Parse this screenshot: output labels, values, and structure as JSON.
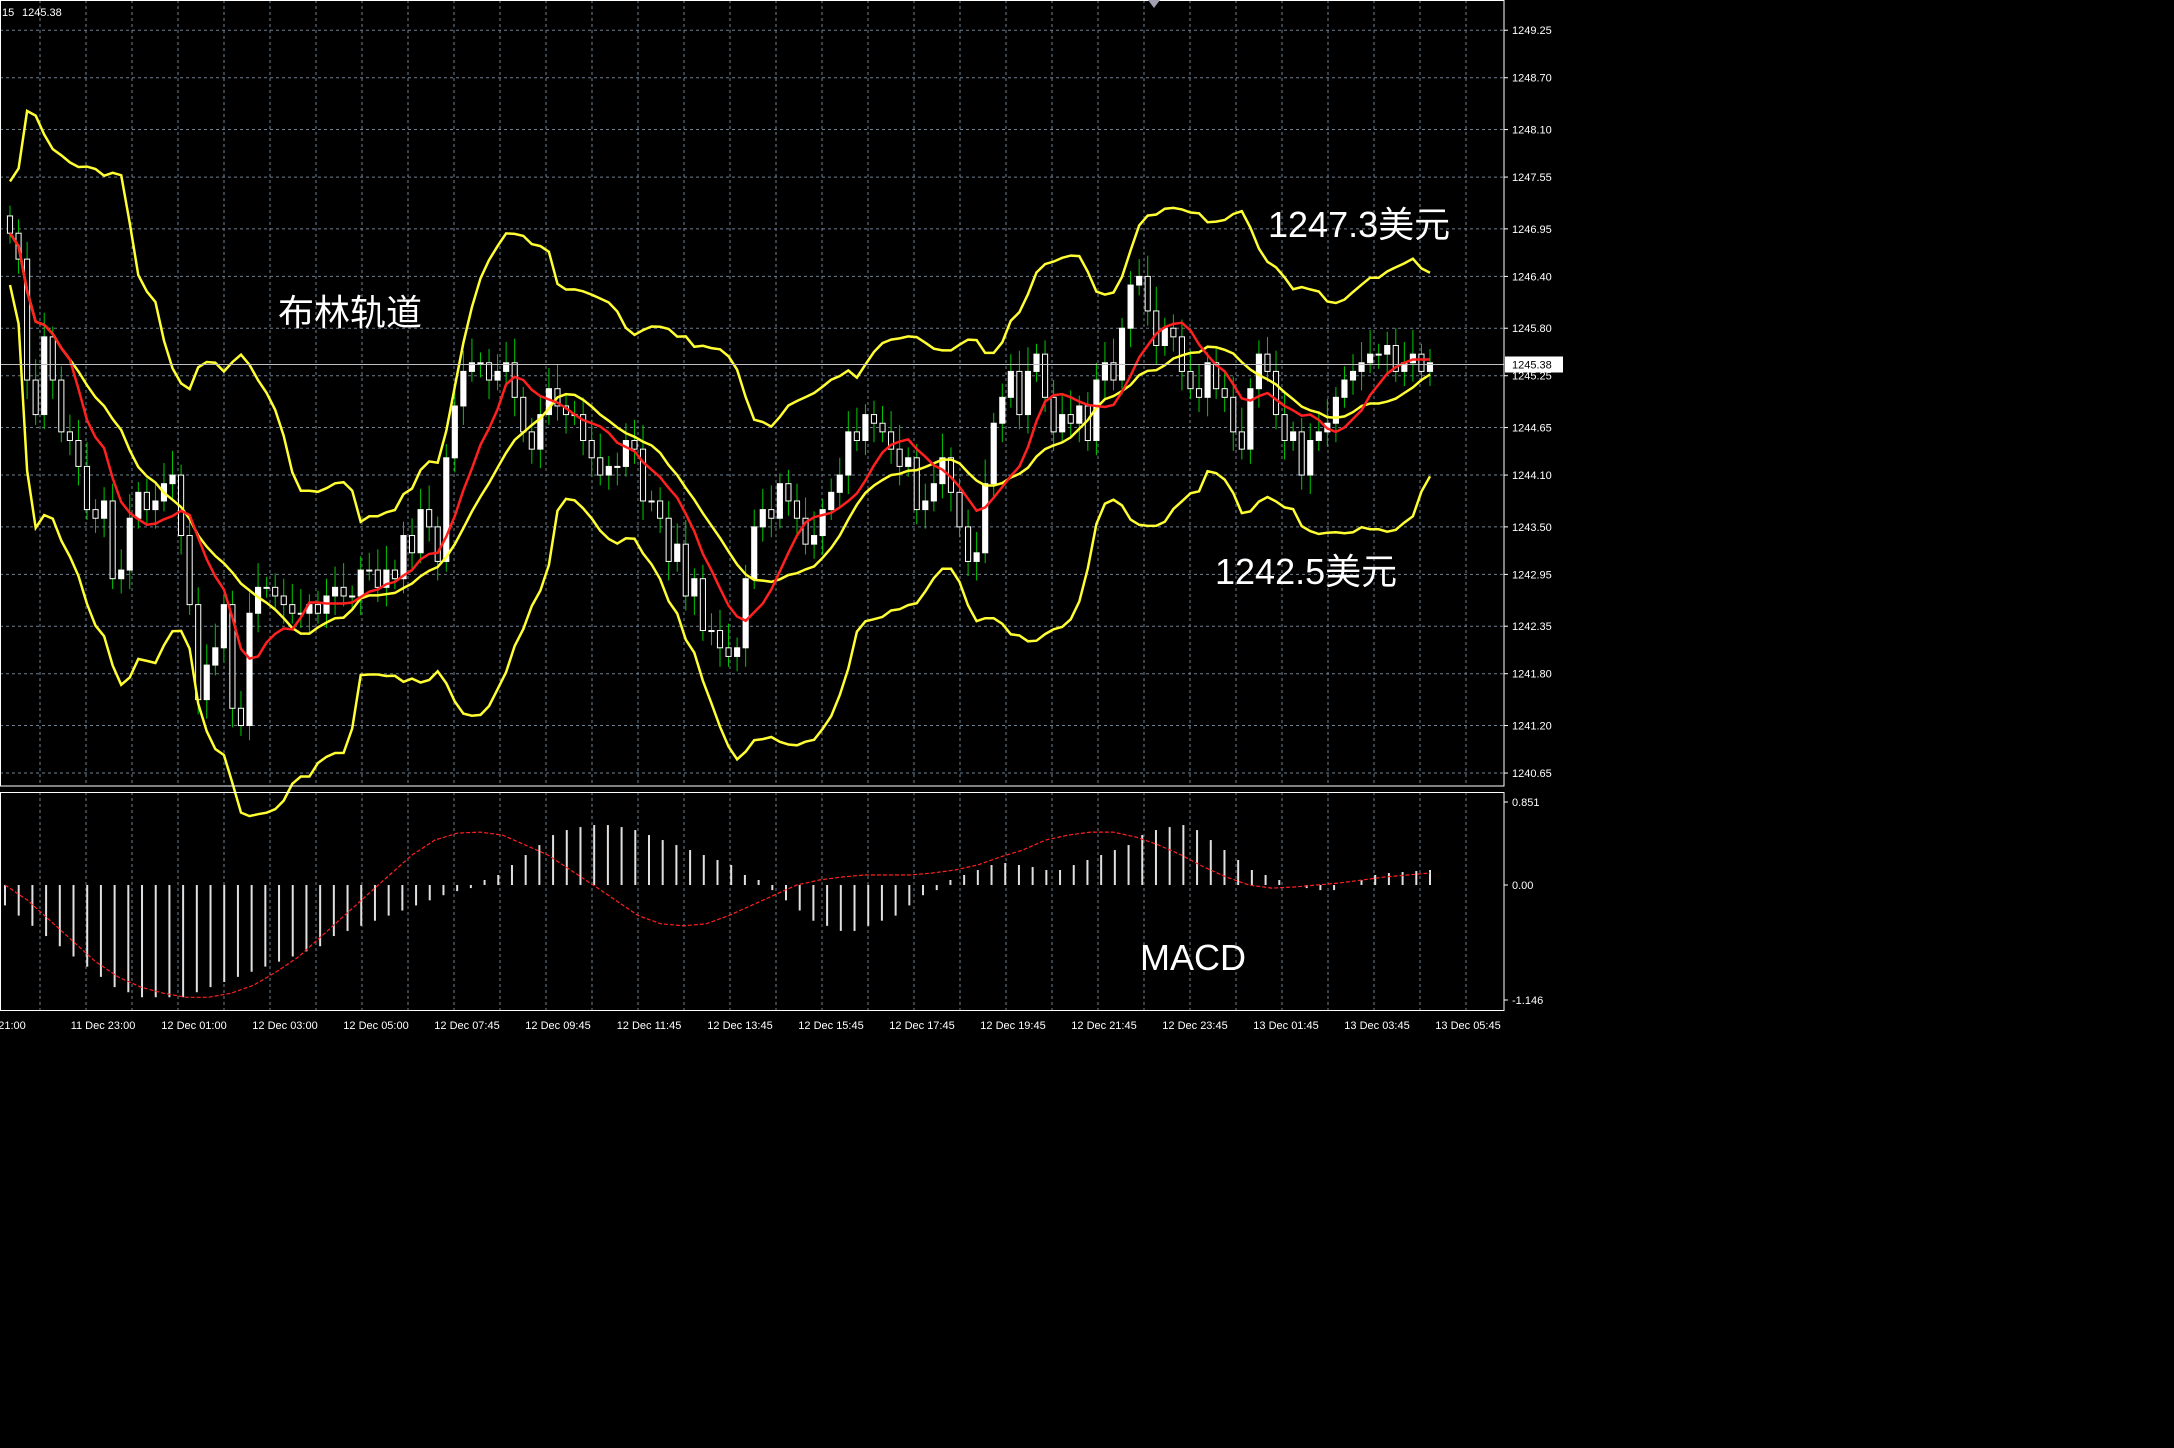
{
  "header": {
    "symbol_label": "15",
    "price_label": "1245.38"
  },
  "annotations": {
    "bands": "布林轨道",
    "upper_target": "1247.3美元",
    "lower_target": "1242.5美元",
    "macd": "MACD"
  },
  "colors": {
    "background": "#000000",
    "grid": "#6f8090",
    "axis_text": "#ffffff",
    "bull_candle": "#ffffff",
    "bear_candle": "#ffffff",
    "wick": "#00c800",
    "band": "#ffff33",
    "middle_ma": "#ffff33",
    "fast_ma": "#ff2020",
    "macd_hist": "#e0e0e0",
    "signal": "#ff2020"
  },
  "chart_data": [
    {
      "type": "candlestick",
      "title": "",
      "ylim": [
        1240.5,
        1249.6
      ],
      "y_ticks": [
        "1249.25",
        "1248.70",
        "1248.10",
        "1247.55",
        "1246.95",
        "1246.40",
        "1245.80",
        "1245.25",
        "1244.65",
        "1244.10",
        "1243.50",
        "1242.95",
        "1242.35",
        "1241.80",
        "1241.20",
        "1240.65"
      ],
      "current_price": "1245.38",
      "x_tick_labels": [
        "21:00",
        "11 Dec 23:00",
        "12 Dec 01:00",
        "12 Dec 03:00",
        "12 Dec 05:00",
        "12 Dec 07:45",
        "12 Dec 09:45",
        "12 Dec 11:45",
        "12 Dec 13:45",
        "12 Dec 15:45",
        "12 Dec 17:45",
        "12 Dec 19:45",
        "12 Dec 21:45",
        "12 Dec 23:45",
        "13 Dec 01:45",
        "13 Dec 03:45",
        "13 Dec 05:45"
      ],
      "close": [
        1246.9,
        1246.6,
        1245.2,
        1244.8,
        1245.7,
        1245.2,
        1244.6,
        1244.5,
        1244.2,
        1243.7,
        1243.6,
        1243.8,
        1242.9,
        1243.0,
        1243.6,
        1243.9,
        1243.7,
        1243.8,
        1244.0,
        1244.1,
        1243.4,
        1242.6,
        1241.5,
        1241.9,
        1242.1,
        1242.6,
        1241.4,
        1241.2,
        1242.5,
        1242.8,
        1242.8,
        1242.7,
        1242.6,
        1242.5,
        1242.5,
        1242.6,
        1242.5,
        1242.7,
        1242.8,
        1242.7,
        1242.7,
        1243.0,
        1243.0,
        1242.8,
        1243.0,
        1242.9,
        1243.4,
        1243.2,
        1243.7,
        1243.5,
        1243.1,
        1244.3,
        1244.9,
        1245.3,
        1245.4,
        1245.4,
        1245.2,
        1245.3,
        1245.4,
        1245.0,
        1244.6,
        1244.4,
        1244.8,
        1245.1,
        1244.9,
        1244.8,
        1244.8,
        1244.5,
        1244.3,
        1244.1,
        1244.2,
        1244.2,
        1244.5,
        1244.4,
        1243.8,
        1243.8,
        1243.6,
        1243.1,
        1243.3,
        1242.7,
        1242.9,
        1242.3,
        1242.3,
        1242.1,
        1242.0,
        1242.1,
        1242.9,
        1243.5,
        1243.7,
        1243.6,
        1244.0,
        1243.8,
        1243.6,
        1243.3,
        1243.4,
        1243.7,
        1243.9,
        1244.1,
        1244.6,
        1244.5,
        1244.8,
        1244.7,
        1244.6,
        1244.4,
        1244.2,
        1244.3,
        1243.7,
        1243.8,
        1244.0,
        1244.3,
        1243.9,
        1243.5,
        1243.1,
        1243.2,
        1244.0,
        1244.7,
        1245.0,
        1245.3,
        1244.8,
        1245.3,
        1245.5,
        1245.0,
        1244.6,
        1244.8,
        1244.7,
        1244.9,
        1244.5,
        1245.2,
        1245.4,
        1245.2,
        1245.8,
        1246.3,
        1246.4,
        1246.0,
        1245.6,
        1245.8,
        1245.7,
        1245.3,
        1245.1,
        1245.0,
        1245.4,
        1245.1,
        1245.0,
        1244.6,
        1244.4,
        1245.1,
        1245.5,
        1245.3,
        1244.8,
        1244.5,
        1244.6,
        1244.1,
        1244.5,
        1244.6,
        1244.7,
        1245.0,
        1245.2,
        1245.3,
        1245.4,
        1245.5,
        1245.5,
        1245.6,
        1245.3,
        1245.4,
        1245.5,
        1245.3,
        1245.4
      ]
    },
    {
      "type": "bar",
      "title": "",
      "ylim": [
        -1.146,
        0.851
      ],
      "y_ticks": [
        "0.851",
        "0.00",
        "-1.146"
      ],
      "values": [
        -0.2,
        -0.3,
        -0.4,
        -0.5,
        -0.6,
        -0.7,
        -0.8,
        -0.9,
        -1.0,
        -1.05,
        -1.1,
        -1.1,
        -1.1,
        -1.1,
        -1.05,
        -1.0,
        -0.95,
        -0.9,
        -0.85,
        -0.8,
        -0.75,
        -0.7,
        -0.65,
        -0.6,
        -0.5,
        -0.45,
        -0.4,
        -0.35,
        -0.3,
        -0.25,
        -0.2,
        -0.15,
        -0.1,
        -0.06,
        -0.03,
        0.05,
        0.1,
        0.2,
        0.3,
        0.4,
        0.5,
        0.55,
        0.58,
        0.6,
        0.6,
        0.58,
        0.55,
        0.5,
        0.45,
        0.4,
        0.35,
        0.3,
        0.25,
        0.2,
        0.1,
        0.05,
        -0.05,
        -0.15,
        -0.25,
        -0.35,
        -0.4,
        -0.45,
        -0.45,
        -0.4,
        -0.35,
        -0.3,
        -0.2,
        -0.1,
        -0.05,
        0.05,
        0.1,
        0.15,
        0.2,
        0.22,
        0.2,
        0.18,
        0.15,
        0.15,
        0.2,
        0.25,
        0.3,
        0.35,
        0.4,
        0.5,
        0.55,
        0.58,
        0.6,
        0.55,
        0.45,
        0.35,
        0.25,
        0.15,
        0.1,
        0.05,
        0.0,
        -0.03,
        -0.05,
        -0.05,
        0.0,
        0.05,
        0.1,
        0.12,
        0.13,
        0.14,
        0.15
      ],
      "signal": [
        0.0,
        -0.15,
        -0.35,
        -0.55,
        -0.75,
        -0.9,
        -1.0,
        -1.06,
        -1.1,
        -1.1,
        -1.06,
        -0.98,
        -0.85,
        -0.7,
        -0.5,
        -0.3,
        -0.1,
        0.1,
        0.3,
        0.45,
        0.52,
        0.53,
        0.5,
        0.4,
        0.3,
        0.15,
        0.0,
        -0.15,
        -0.3,
        -0.38,
        -0.4,
        -0.38,
        -0.3,
        -0.2,
        -0.1,
        0.0,
        0.05,
        0.08,
        0.1,
        0.1,
        0.1,
        0.12,
        0.15,
        0.2,
        0.28,
        0.35,
        0.45,
        0.5,
        0.53,
        0.53,
        0.48,
        0.4,
        0.3,
        0.18,
        0.08,
        0.0,
        -0.03,
        -0.02,
        0.0,
        0.02,
        0.05,
        0.08,
        0.1,
        0.12
      ]
    }
  ]
}
